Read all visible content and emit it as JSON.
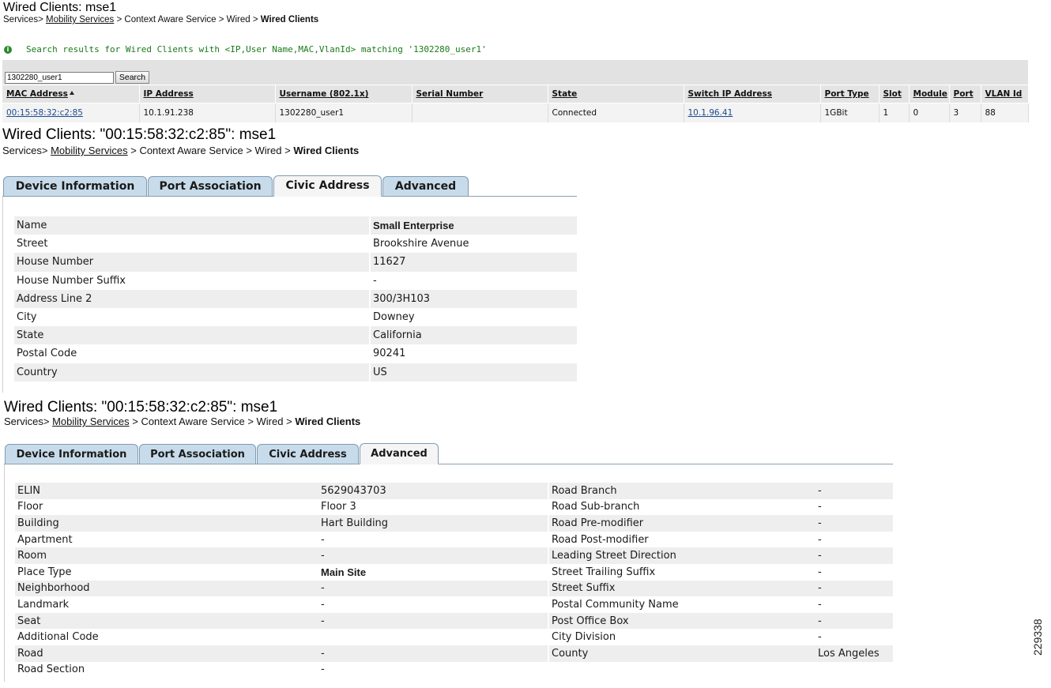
{
  "section1": {
    "title": "Wired Clients: mse1",
    "breadcrumb": {
      "part1": "Services>",
      "link": "Mobility Services",
      "part2": "> Context Aware Service > Wired >",
      "current": "Wired Clients"
    },
    "info_message": "Search results for Wired Clients with <IP,User Name,MAC,VlanId> matching '1302280_user1'",
    "search": {
      "value": "1302280_user1",
      "button": "Search"
    },
    "columns": [
      "MAC Address",
      "IP Address",
      "Username (802.1x)",
      "Serial Number",
      "State",
      "Switch IP Address",
      "Port Type",
      "Slot",
      "Module",
      "Port",
      "VLAN Id"
    ],
    "row": {
      "mac": "00:15:58:32:c2:85",
      "ip": "10.1.91.238",
      "username": "1302280_user1",
      "serial": "",
      "state": "Connected",
      "switch_ip": "10.1.96.41",
      "port_type": "1GBit",
      "slot": "1",
      "module": "0",
      "port": "3",
      "vlan": "88"
    }
  },
  "section2": {
    "title": "Wired Clients: \"00:15:58:32:c2:85\": mse1",
    "breadcrumb": {
      "part1": "Services>",
      "link": "Mobility Services",
      "part2": "> Context Aware Service > Wired >",
      "current": "Wired Clients"
    },
    "tabs": [
      "Device Information",
      "Port Association",
      "Civic Address",
      "Advanced"
    ],
    "active_tab": "Civic Address",
    "rows": [
      {
        "label": "Name",
        "value": "Small Enterprise"
      },
      {
        "label": "Street",
        "value": "Brookshire Avenue"
      },
      {
        "label": "House Number",
        "value": "11627"
      },
      {
        "label": "House Number Suffix",
        "value": "-"
      },
      {
        "label": "Address Line 2",
        "value": "300/3H103"
      },
      {
        "label": "City",
        "value": "Downey"
      },
      {
        "label": "State",
        "value": "California"
      },
      {
        "label": "Postal Code",
        "value": "90241"
      },
      {
        "label": "Country",
        "value": "US"
      }
    ]
  },
  "section3": {
    "title": "Wired Clients: \"00:15:58:32:c2:85\": mse1",
    "breadcrumb": {
      "part1": "Services>",
      "link": "Mobility Services",
      "part2": "> Context Aware Service > Wired >",
      "current": "Wired Clients"
    },
    "tabs": [
      "Device Information",
      "Port Association",
      "Civic Address",
      "Advanced"
    ],
    "active_tab": "Advanced",
    "rows": [
      {
        "l1": "ELIN",
        "v1": "5629043703",
        "l2": "Road Branch",
        "v2": "-"
      },
      {
        "l1": "Floor",
        "v1": "Floor 3",
        "l2": "Road Sub-branch",
        "v2": "-"
      },
      {
        "l1": "Building",
        "v1": "Hart Building",
        "l2": "Road Pre-modifier",
        "v2": "-"
      },
      {
        "l1": "Apartment",
        "v1": "-",
        "l2": "Road Post-modifier",
        "v2": "-"
      },
      {
        "l1": "Room",
        "v1": "-",
        "l2": "Leading Street Direction",
        "v2": "-"
      },
      {
        "l1": "Place Type",
        "v1": "Main Site",
        "l2": "Street Trailing Suffix",
        "v2": "-"
      },
      {
        "l1": "Neighborhood",
        "v1": "-",
        "l2": "Street Suffix",
        "v2": "-"
      },
      {
        "l1": "Landmark",
        "v1": "-",
        "l2": "Postal Community Name",
        "v2": "-"
      },
      {
        "l1": "Seat",
        "v1": "-",
        "l2": "Post Office Box",
        "v2": "-"
      },
      {
        "l1": "Additional Code",
        "v1": "",
        "l2": "City Division",
        "v2": "-"
      },
      {
        "l1": "Road",
        "v1": "-",
        "l2": "County",
        "v2": "Los Angeles"
      },
      {
        "l1": "Road Section",
        "v1": "-",
        "l2": "",
        "v2": ""
      }
    ]
  },
  "figure_id": "229338"
}
